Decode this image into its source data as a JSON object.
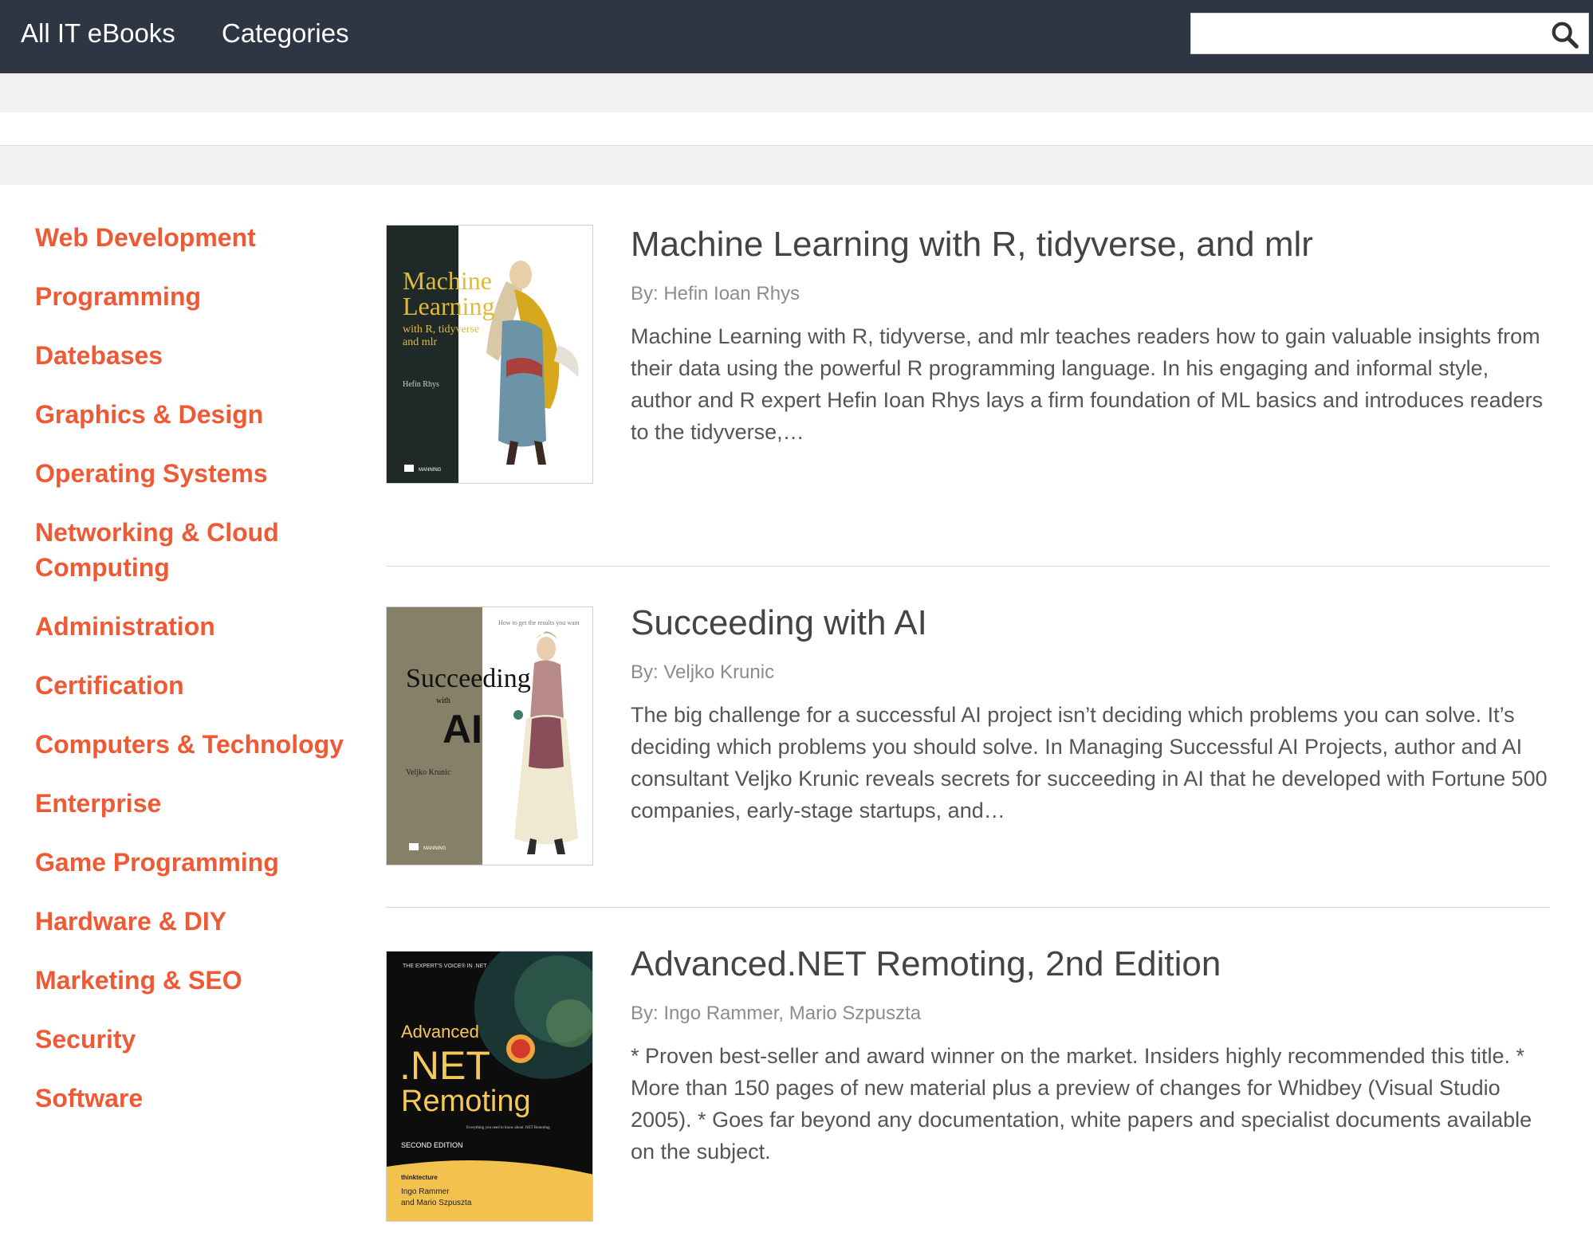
{
  "nav": {
    "home_label": "All IT eBooks",
    "categories_label": "Categories",
    "search_placeholder": ""
  },
  "sidebar": {
    "categories": [
      "Web Development",
      "Programming",
      "Datebases",
      "Graphics & Design",
      "Operating Systems",
      "Networking & Cloud Computing",
      "Administration",
      "Certification",
      "Computers & Technology",
      "Enterprise",
      "Game Programming",
      "Hardware & DIY",
      "Marketing & SEO",
      "Security",
      "Software"
    ]
  },
  "books": [
    {
      "title": "Machine Learning with R, tidyverse, and mlr",
      "author": "By: Hefin Ioan Rhys",
      "description": "Machine Learning with R, tidyverse, and mlr teaches readers how to gain valuable insights from their data using the powerful R programming language. In his engaging and informal style, author and R expert Hefin Ioan Rhys lays a firm foundation of ML basics and introduces readers to the tidyverse,…",
      "cover": {
        "line1": "Machine",
        "line2": "Learning",
        "line3": "with R, tidyverse",
        "line4": "and mlr",
        "author": "Hefin Rhys",
        "publisher": "MANNING"
      }
    },
    {
      "title": "Succeeding with AI",
      "author": "By: Veljko Krunic",
      "description": "The big challenge for a successful AI project isn’t deciding which problems you can solve. It’s deciding which problems you should solve. In Managing Successful AI Projects, author and AI consultant Veljko Krunic reveals secrets for succeeding in AI that he developed with Fortune 500 companies, early-stage startups, and…",
      "cover": {
        "tagline": "How to get the results you want",
        "line1": "Succeeding",
        "line2": "with",
        "line3": "AI",
        "author": "Veljko Krunic",
        "publisher": "MANNING"
      }
    },
    {
      "title": "Advanced.NET Remoting, 2nd Edition",
      "author": "By: Ingo Rammer, Mario Szpuszta",
      "description": "* Proven best-seller and award winner on the market. Insiders highly recommended this title. * More than 150 pages of new material plus a preview of changes for Whidbey (Visual Studio 2005). * Goes far beyond any documentation, white papers and specialist documents available on the subject.",
      "cover": {
        "series": "THE EXPERT'S VOICE® IN .NET",
        "line1": "Advanced",
        "line2": ".NET",
        "line3": "Remoting",
        "subtitle": "Everything you need to know about .NET Remoting",
        "edition": "SECOND EDITION",
        "badge": "thinktecture",
        "author1": "Ingo Rammer",
        "author2": "and Mario Szpuszta"
      }
    }
  ]
}
